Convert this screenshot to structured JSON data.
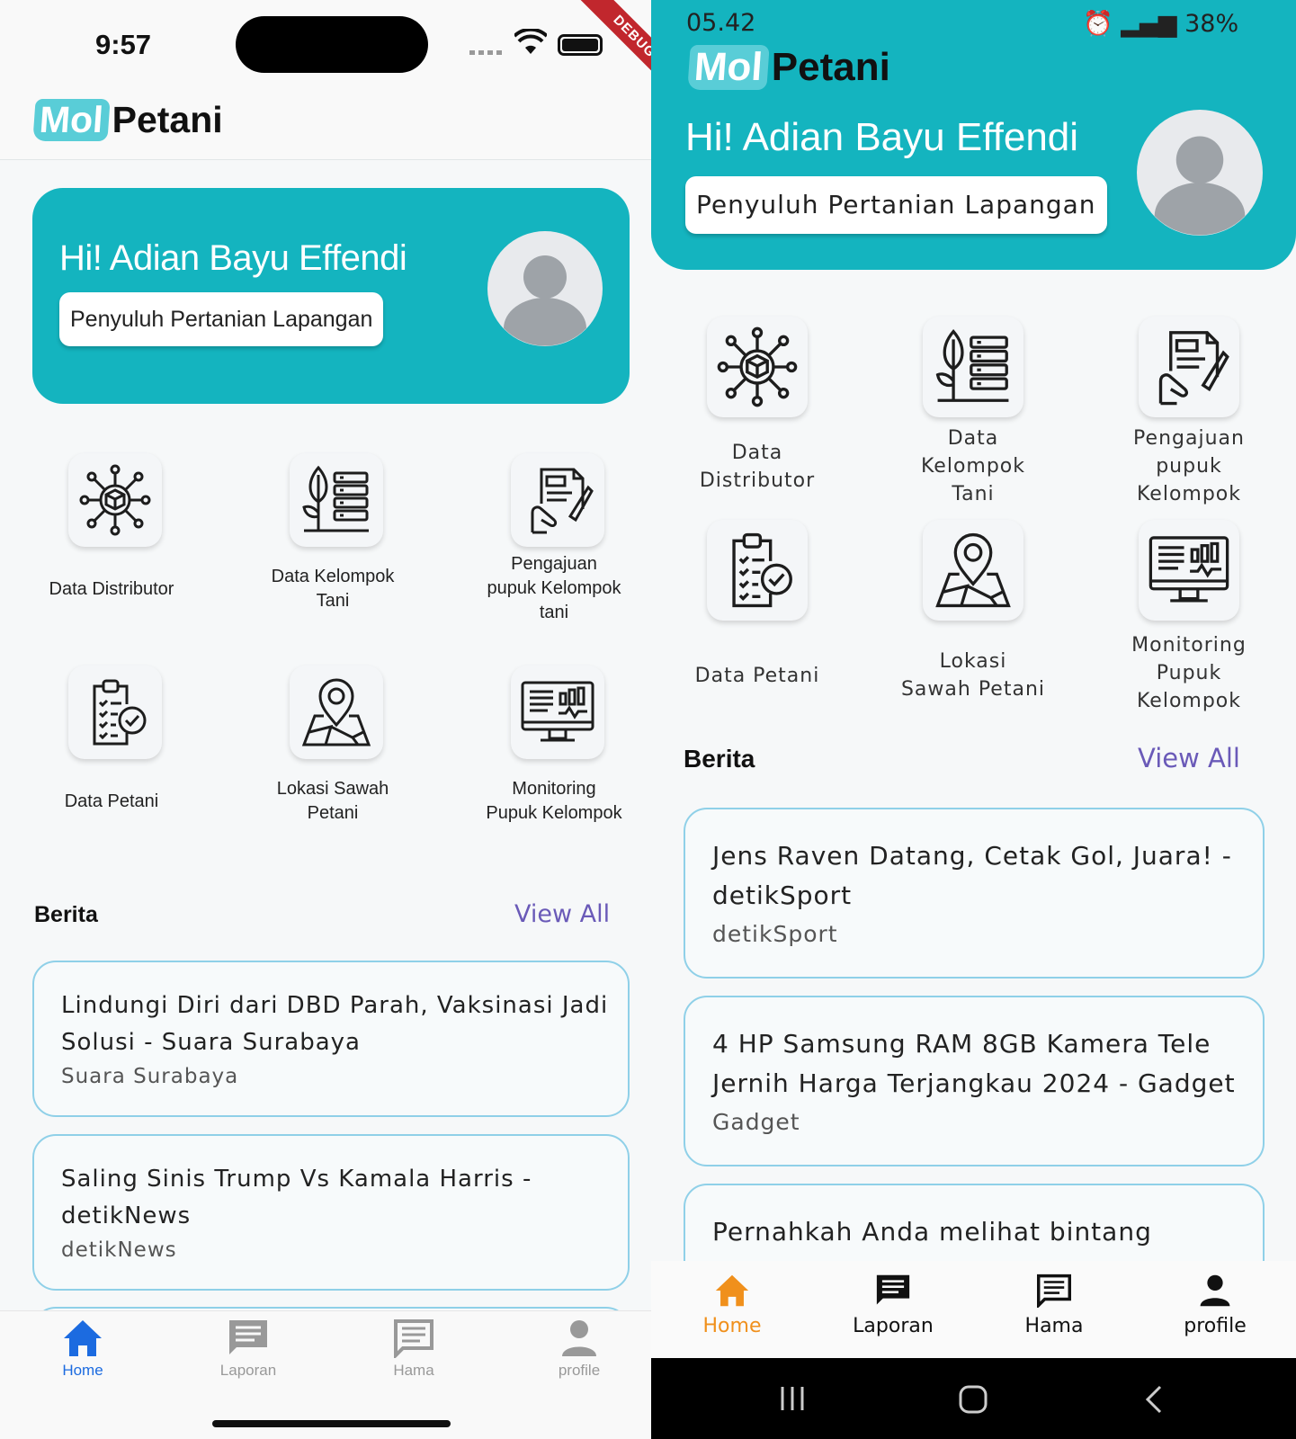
{
  "ios": {
    "status": {
      "time": "9:57",
      "debug_banner": "DEBUG"
    },
    "logo": {
      "mol": "Mol",
      "petani": "Petani"
    },
    "hero": {
      "greeting": "Hi! Adian Bayu Effendi",
      "role": "Penyuluh Pertanian Lapangan"
    },
    "menu": [
      {
        "label": "Data Distributor",
        "icon": "distributor-network-icon"
      },
      {
        "label": "Data Kelompok\nTani",
        "icon": "plant-database-icon"
      },
      {
        "label": "Pengajuan\npupuk Kelompok\ntani",
        "icon": "document-submission-icon"
      },
      {
        "label": "Data Petani",
        "icon": "clipboard-check-icon"
      },
      {
        "label": "Lokasi Sawah\nPetani",
        "icon": "map-pin-icon"
      },
      {
        "label": "Monitoring\nPupuk Kelompok",
        "icon": "monitor-chart-icon"
      }
    ],
    "news_section": {
      "title": "Berita",
      "view_all": "View All"
    },
    "news": [
      {
        "title": "Lindungi Diri dari DBD Parah, Vaksinasi Jadi\nSolusi - Suara Surabaya",
        "source": "Suara Surabaya"
      },
      {
        "title": "Saling Sinis Trump Vs Kamala Harris -\ndetikNews",
        "source": "detikNews"
      }
    ],
    "tabs": [
      {
        "label": "Home",
        "icon": "home-icon",
        "active": true
      },
      {
        "label": "Laporan",
        "icon": "message-icon",
        "active": false
      },
      {
        "label": "Hama",
        "icon": "list-message-icon",
        "active": false
      },
      {
        "label": "profile",
        "icon": "person-icon",
        "active": false
      }
    ],
    "colors": {
      "primary": "#14b4bf",
      "active_tab": "#1c6be0",
      "view_all": "#6a5ab8"
    }
  },
  "android": {
    "status": {
      "time": "05.42",
      "right": "38%"
    },
    "logo": {
      "mol": "Mol",
      "petani": "Petani"
    },
    "hero": {
      "greeting": "Hi! Adian Bayu Effendi",
      "role": "Penyuluh Pertanian Lapangan"
    },
    "menu": [
      {
        "label": "Data\nDistributor",
        "icon": "distributor-network-icon"
      },
      {
        "label": "Data\nKelompok\nTani",
        "icon": "plant-database-icon"
      },
      {
        "label": "Pengajuan\npupuk\nKelompok",
        "icon": "document-submission-icon"
      },
      {
        "label": "Data Petani",
        "icon": "clipboard-check-icon"
      },
      {
        "label": "Lokasi\nSawah Petani",
        "icon": "map-pin-icon"
      },
      {
        "label": "Monitoring\nPupuk\nKelompok",
        "icon": "monitor-chart-icon"
      }
    ],
    "news_section": {
      "title": "Berita",
      "view_all": "View All"
    },
    "news": [
      {
        "title": "Jens Raven Datang, Cetak Gol, Juara! -\ndetikSport",
        "source": "detikSport"
      },
      {
        "title": "4 HP Samsung RAM 8GB Kamera Tele\nJernih Harga Terjangkau 2024 - Gadget",
        "source": "Gadget"
      },
      {
        "title": "Pernahkah Anda melihat bintang",
        "source": ""
      }
    ],
    "tabs": [
      {
        "label": "Home",
        "icon": "home-icon",
        "active": true
      },
      {
        "label": "Laporan",
        "icon": "message-icon",
        "active": false
      },
      {
        "label": "Hama",
        "icon": "list-message-icon",
        "active": false
      },
      {
        "label": "profile",
        "icon": "person-icon",
        "active": false
      }
    ],
    "colors": {
      "primary": "#14b4bf",
      "active_tab": "#f0901c"
    }
  }
}
